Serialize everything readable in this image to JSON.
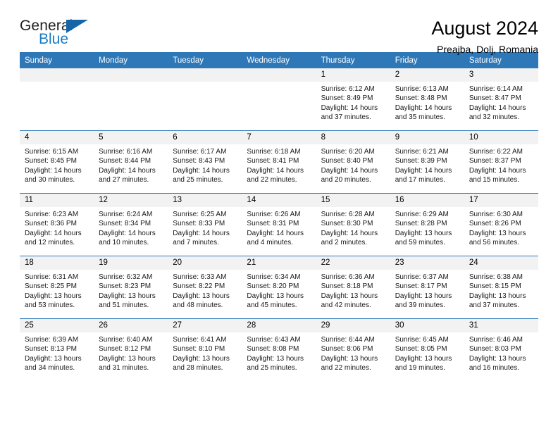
{
  "brand": {
    "name_part1": "General",
    "name_part2": "Blue",
    "triangle_color": "#1565a8",
    "blue_color": "#1a7cc2"
  },
  "header": {
    "title": "August 2024",
    "subtitle": "Preajba, Dolj, Romania"
  },
  "theme": {
    "header_blue": "#2e78b8",
    "daynum_background": "#f2f2f2"
  },
  "weekdays": [
    "Sunday",
    "Monday",
    "Tuesday",
    "Wednesday",
    "Thursday",
    "Friday",
    "Saturday"
  ],
  "weeks": [
    [
      {
        "day": "",
        "empty": true
      },
      {
        "day": "",
        "empty": true
      },
      {
        "day": "",
        "empty": true
      },
      {
        "day": "",
        "empty": true
      },
      {
        "day": "1",
        "sunrise": "Sunrise: 6:12 AM",
        "sunset": "Sunset: 8:49 PM",
        "daylight": "Daylight: 14 hours and 37 minutes."
      },
      {
        "day": "2",
        "sunrise": "Sunrise: 6:13 AM",
        "sunset": "Sunset: 8:48 PM",
        "daylight": "Daylight: 14 hours and 35 minutes."
      },
      {
        "day": "3",
        "sunrise": "Sunrise: 6:14 AM",
        "sunset": "Sunset: 8:47 PM",
        "daylight": "Daylight: 14 hours and 32 minutes."
      }
    ],
    [
      {
        "day": "4",
        "sunrise": "Sunrise: 6:15 AM",
        "sunset": "Sunset: 8:45 PM",
        "daylight": "Daylight: 14 hours and 30 minutes."
      },
      {
        "day": "5",
        "sunrise": "Sunrise: 6:16 AM",
        "sunset": "Sunset: 8:44 PM",
        "daylight": "Daylight: 14 hours and 27 minutes."
      },
      {
        "day": "6",
        "sunrise": "Sunrise: 6:17 AM",
        "sunset": "Sunset: 8:43 PM",
        "daylight": "Daylight: 14 hours and 25 minutes."
      },
      {
        "day": "7",
        "sunrise": "Sunrise: 6:18 AM",
        "sunset": "Sunset: 8:41 PM",
        "daylight": "Daylight: 14 hours and 22 minutes."
      },
      {
        "day": "8",
        "sunrise": "Sunrise: 6:20 AM",
        "sunset": "Sunset: 8:40 PM",
        "daylight": "Daylight: 14 hours and 20 minutes."
      },
      {
        "day": "9",
        "sunrise": "Sunrise: 6:21 AM",
        "sunset": "Sunset: 8:39 PM",
        "daylight": "Daylight: 14 hours and 17 minutes."
      },
      {
        "day": "10",
        "sunrise": "Sunrise: 6:22 AM",
        "sunset": "Sunset: 8:37 PM",
        "daylight": "Daylight: 14 hours and 15 minutes."
      }
    ],
    [
      {
        "day": "11",
        "sunrise": "Sunrise: 6:23 AM",
        "sunset": "Sunset: 8:36 PM",
        "daylight": "Daylight: 14 hours and 12 minutes."
      },
      {
        "day": "12",
        "sunrise": "Sunrise: 6:24 AM",
        "sunset": "Sunset: 8:34 PM",
        "daylight": "Daylight: 14 hours and 10 minutes."
      },
      {
        "day": "13",
        "sunrise": "Sunrise: 6:25 AM",
        "sunset": "Sunset: 8:33 PM",
        "daylight": "Daylight: 14 hours and 7 minutes."
      },
      {
        "day": "14",
        "sunrise": "Sunrise: 6:26 AM",
        "sunset": "Sunset: 8:31 PM",
        "daylight": "Daylight: 14 hours and 4 minutes."
      },
      {
        "day": "15",
        "sunrise": "Sunrise: 6:28 AM",
        "sunset": "Sunset: 8:30 PM",
        "daylight": "Daylight: 14 hours and 2 minutes."
      },
      {
        "day": "16",
        "sunrise": "Sunrise: 6:29 AM",
        "sunset": "Sunset: 8:28 PM",
        "daylight": "Daylight: 13 hours and 59 minutes."
      },
      {
        "day": "17",
        "sunrise": "Sunrise: 6:30 AM",
        "sunset": "Sunset: 8:26 PM",
        "daylight": "Daylight: 13 hours and 56 minutes."
      }
    ],
    [
      {
        "day": "18",
        "sunrise": "Sunrise: 6:31 AM",
        "sunset": "Sunset: 8:25 PM",
        "daylight": "Daylight: 13 hours and 53 minutes."
      },
      {
        "day": "19",
        "sunrise": "Sunrise: 6:32 AM",
        "sunset": "Sunset: 8:23 PM",
        "daylight": "Daylight: 13 hours and 51 minutes."
      },
      {
        "day": "20",
        "sunrise": "Sunrise: 6:33 AM",
        "sunset": "Sunset: 8:22 PM",
        "daylight": "Daylight: 13 hours and 48 minutes."
      },
      {
        "day": "21",
        "sunrise": "Sunrise: 6:34 AM",
        "sunset": "Sunset: 8:20 PM",
        "daylight": "Daylight: 13 hours and 45 minutes."
      },
      {
        "day": "22",
        "sunrise": "Sunrise: 6:36 AM",
        "sunset": "Sunset: 8:18 PM",
        "daylight": "Daylight: 13 hours and 42 minutes."
      },
      {
        "day": "23",
        "sunrise": "Sunrise: 6:37 AM",
        "sunset": "Sunset: 8:17 PM",
        "daylight": "Daylight: 13 hours and 39 minutes."
      },
      {
        "day": "24",
        "sunrise": "Sunrise: 6:38 AM",
        "sunset": "Sunset: 8:15 PM",
        "daylight": "Daylight: 13 hours and 37 minutes."
      }
    ],
    [
      {
        "day": "25",
        "sunrise": "Sunrise: 6:39 AM",
        "sunset": "Sunset: 8:13 PM",
        "daylight": "Daylight: 13 hours and 34 minutes."
      },
      {
        "day": "26",
        "sunrise": "Sunrise: 6:40 AM",
        "sunset": "Sunset: 8:12 PM",
        "daylight": "Daylight: 13 hours and 31 minutes."
      },
      {
        "day": "27",
        "sunrise": "Sunrise: 6:41 AM",
        "sunset": "Sunset: 8:10 PM",
        "daylight": "Daylight: 13 hours and 28 minutes."
      },
      {
        "day": "28",
        "sunrise": "Sunrise: 6:43 AM",
        "sunset": "Sunset: 8:08 PM",
        "daylight": "Daylight: 13 hours and 25 minutes."
      },
      {
        "day": "29",
        "sunrise": "Sunrise: 6:44 AM",
        "sunset": "Sunset: 8:06 PM",
        "daylight": "Daylight: 13 hours and 22 minutes."
      },
      {
        "day": "30",
        "sunrise": "Sunrise: 6:45 AM",
        "sunset": "Sunset: 8:05 PM",
        "daylight": "Daylight: 13 hours and 19 minutes."
      },
      {
        "day": "31",
        "sunrise": "Sunrise: 6:46 AM",
        "sunset": "Sunset: 8:03 PM",
        "daylight": "Daylight: 13 hours and 16 minutes."
      }
    ]
  ]
}
